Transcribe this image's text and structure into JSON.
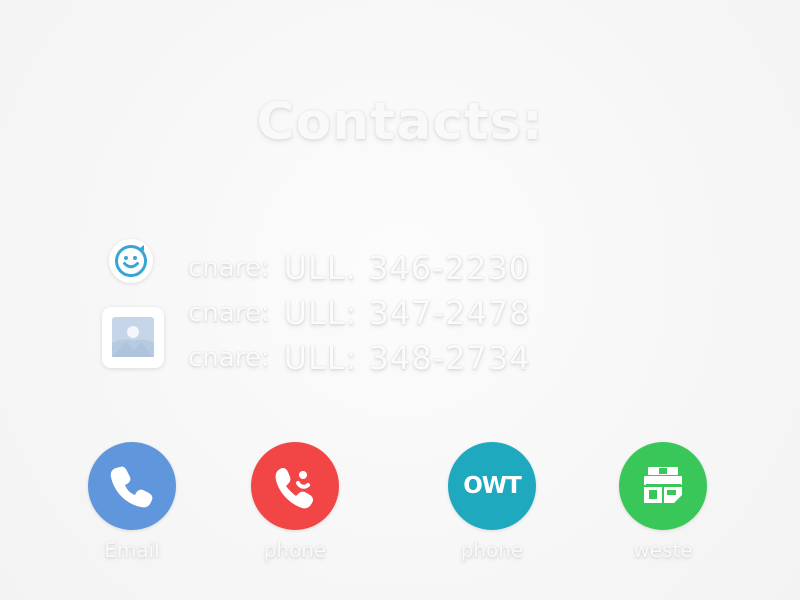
{
  "screen": {
    "title": "Contacts:"
  },
  "contacts": [
    {
      "prefix": "cnare:",
      "number": "ULL. 346-2230",
      "icon": "smile-icon"
    },
    {
      "prefix": "cnare:",
      "number": "ULL: 347-2478",
      "icon": "photo-icon"
    },
    {
      "prefix": "cnare:",
      "number": "ULL: 348-2734"
    }
  ],
  "apps": [
    {
      "label": "Email",
      "icon": "phone-icon",
      "color": "#6097dc"
    },
    {
      "label": "phone",
      "icon": "phone-chat-icon",
      "color": "#f24646"
    },
    {
      "label": "phone",
      "icon": "owt-logo-icon",
      "icon_text": "OWT",
      "color": "#1fa9bf"
    },
    {
      "label": "weste",
      "icon": "map-tile-icon",
      "color": "#39c75a"
    }
  ]
}
